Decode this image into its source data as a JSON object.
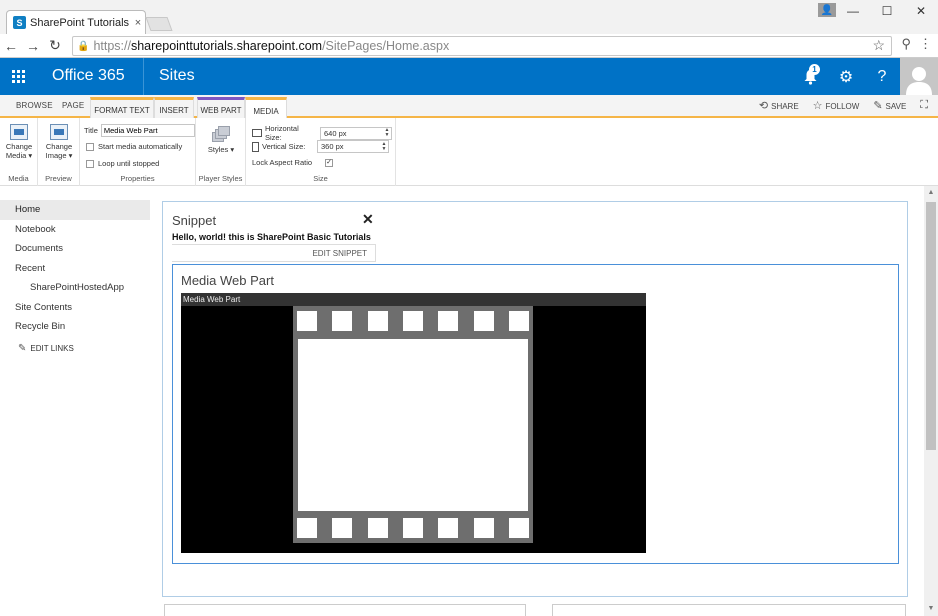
{
  "browser": {
    "tab_title": "SharePoint Tutorials Team",
    "tab_close": "×",
    "window_buttons": [
      "—",
      "☐",
      "✕"
    ],
    "url_scheme": "https://",
    "url_host": "sharepointtutorials.sharepoint.com",
    "url_path": "/SitePages/Home.aspx"
  },
  "suitebar": {
    "brand": "Office 365",
    "app": "Sites",
    "notification_count": "1",
    "help_label": "?",
    "bg_color": "#0072c6"
  },
  "ribbon": {
    "tabs": [
      "BROWSE",
      "PAGE",
      "FORMAT TEXT",
      "INSERT",
      "WEB PART",
      "MEDIA"
    ],
    "actions": {
      "share": "SHARE",
      "follow": "FOLLOW",
      "save": "SAVE"
    },
    "groups": {
      "media": {
        "label": "Media",
        "change_media": "Change Media ▾"
      },
      "preview": {
        "label": "Preview",
        "change_image": "Change Image ▾"
      },
      "properties": {
        "label": "Properties",
        "title_label": "Title",
        "title_value": "Media Web Part",
        "start_auto": "Start media automatically",
        "start_auto_checked": false,
        "loop": "Loop until stopped",
        "loop_checked": false
      },
      "player_styles": {
        "label": "Player Styles",
        "styles_button": "Styles ▾"
      },
      "size": {
        "label": "Size",
        "horizontal_label": "Horizontal Size:",
        "horizontal_value": "640 px",
        "vertical_label": "Vertical Size:",
        "vertical_value": "360 px",
        "lock_aspect": "Lock Aspect Ratio",
        "lock_aspect_checked": true
      }
    }
  },
  "leftnav": {
    "items": [
      {
        "label": "Home"
      },
      {
        "label": "Notebook"
      },
      {
        "label": "Documents"
      },
      {
        "label": "Recent"
      },
      {
        "label": "SharePointHostedApp"
      },
      {
        "label": "Site Contents"
      },
      {
        "label": "Recycle Bin"
      }
    ],
    "edit_links": "EDIT LINKS"
  },
  "snippet": {
    "title": "Snippet",
    "close": "✕",
    "content": "Hello, world! this is SharePoint Basic Tutorials",
    "edit": "EDIT SNIPPET"
  },
  "media_web_part": {
    "title": "Media Web Part",
    "player_label": "Media Web Part"
  }
}
